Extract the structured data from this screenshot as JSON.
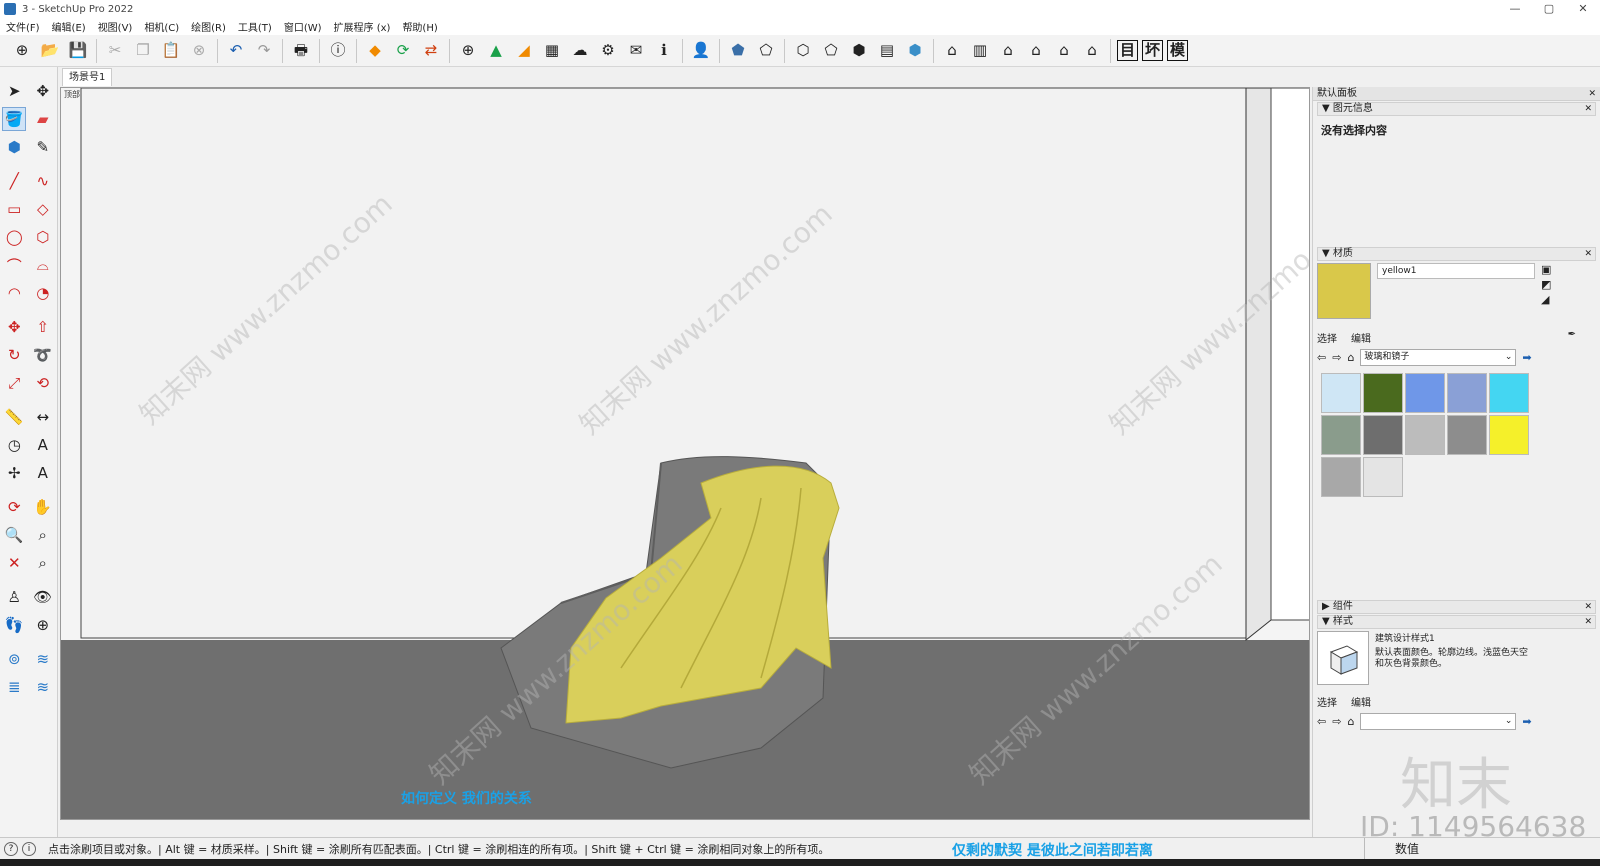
{
  "window": {
    "title": "3 - SketchUp Pro 2022",
    "buttons": [
      "—",
      "▢",
      "✕"
    ]
  },
  "menu": [
    "文件(F)",
    "编辑(E)",
    "视图(V)",
    "相机(C)",
    "绘图(R)",
    "工具(T)",
    "窗口(W)",
    "扩展程序 (x)",
    "帮助(H)"
  ],
  "toolbar": {
    "text_buttons": [
      "目",
      "坏",
      "模"
    ]
  },
  "scene": {
    "tab_label": "场景号1",
    "corner_label": "顶部"
  },
  "viewport": {
    "caption": "如何定义  我们的关系",
    "watermark": "知末网 www.znzmo.com",
    "colors": {
      "sky": "#f4f4f4",
      "ground": "#6f6f6f",
      "fabric": "#d9cf5b",
      "chair": "#7a7a7a"
    }
  },
  "right_panel": {
    "title": "默认面板",
    "entity_info": {
      "header": "图元信息",
      "content": "没有选择内容"
    },
    "materials": {
      "header": "材质",
      "name": "yellow1",
      "swatch_color": "#d9c84a",
      "tabs": [
        "选择",
        "编辑"
      ],
      "library": "玻璃和镜子",
      "swatches": [
        "#cfe6f5",
        "#4a6a1e",
        "#6f97e8",
        "#8aa0d6",
        "#44d6f2",
        "#8a9c8c",
        "#6e6e6e",
        "#bcbcbc",
        "#8d8d8d",
        "#f5f02a",
        "#a8a8a8",
        "#e4e4e4"
      ]
    },
    "components": {
      "header": "组件"
    },
    "styles": {
      "header": "样式",
      "name": "建筑设计样式1",
      "description": "默认表面颜色。轮廓边线。浅蓝色天空和灰色背景颜色。",
      "tabs": [
        "选择",
        "编辑"
      ]
    }
  },
  "status": {
    "message": "点击涂刷项目或对象。| Alt 键 = 材质采样。| Shift 键 = 涂刷所有匹配表面。| Ctrl 键 = 涂刷相连的所有项。| Shift 键 + Ctrl 键 = 涂刷相同对象上的所有项。",
    "caption": "仅剩的默契  是彼此之间若即若离",
    "vcb_label": "数值"
  },
  "overlay": {
    "brand": "知末",
    "id": "ID: 1149564638"
  }
}
